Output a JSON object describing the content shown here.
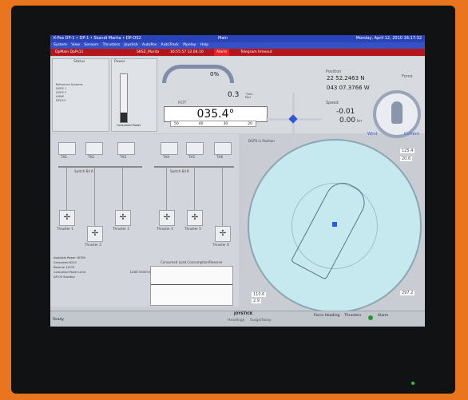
{
  "window": {
    "title_left": "K-Pos DP-1 • DP-1 • Skandi Marita • DP-OS2",
    "title_center": "Main",
    "datetime": "Monday, April 12, 2010 16:17:32"
  },
  "menu": [
    "System",
    "View",
    "Sensors",
    "Thrusters",
    "Joystick",
    "AutoPos",
    "AutoTrack",
    "Pipelay",
    "Help"
  ],
  "toolbar": {
    "session": "DpMain DpPs11",
    "vessel": "SKSZ_Marita",
    "timestamp": "16:55:57 12.04.10",
    "alarm": "Alarm",
    "alarm_text": "Telegram timeout"
  },
  "status_panel": {
    "title": "Status",
    "sensors": [
      "Reference Systems",
      "DGPS 1",
      "DGPS 2",
      "HiPAP",
      "DPGS3"
    ]
  },
  "power_panel": {
    "title": "Power",
    "consumed_label": "Consumed Power"
  },
  "heading_panel": {
    "rate_value": "0",
    "rate_unit": "%",
    "rot_label": "ROT",
    "rot_value": "0.3",
    "rot_unit": "°/min\nPort",
    "heading": "035.4",
    "scale": [
      "50",
      "40",
      "30",
      "20"
    ]
  },
  "position_panel": {
    "position_label": "Position",
    "lat": "22 52.2463 N",
    "lon": "043 07.3766 W",
    "speed_label": "Speed",
    "speed_x": "-0.01",
    "speed_y": "0.00",
    "speed_unit": "kn"
  },
  "force_panel": {
    "title": "Force",
    "left_label": "Wind",
    "right_label": "Current"
  },
  "thrusters": {
    "top_row": [
      "TH1",
      "TH2",
      "TH3",
      "TH4",
      "TH5",
      "TH6"
    ],
    "bus_a": "Switch Bd A",
    "bus_b": "Switch Bd B",
    "fans": [
      "Thruster 1",
      "Thruster 2",
      "Thruster 3",
      "Thruster 4",
      "Thruster 5",
      "Thruster 6"
    ]
  },
  "info_panel": {
    "lines": [
      "Available Power",
      "Consumed",
      "Reserve",
      "Consumed Power Limit",
      "DP-OS Standby"
    ],
    "values": [
      "18780",
      "6210",
      "12570",
      "",
      ""
    ]
  },
  "graph": {
    "title": "Consumed Load Consumption/Reserve",
    "label": "Load reserve"
  },
  "radar": {
    "title": "DGPS in Position",
    "heading_readout": "110.6",
    "range_readout": "2.9",
    "right_values": [
      "125.4",
      "20.6",
      "297.2"
    ]
  },
  "statusbar": {
    "left": "Ready",
    "center": "JOYSTICK",
    "center_sub": [
      "Headings",
      "Surge/Sway"
    ],
    "right1": "Force Heading",
    "right2": "Thrusters",
    "right3": "Alarm"
  }
}
